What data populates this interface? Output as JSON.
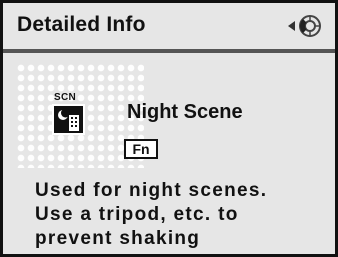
{
  "header": {
    "title": "Detailed Info",
    "nav_icon": "four-way-controller-icon"
  },
  "mode": {
    "scn_label": "SCN",
    "icon": "night-scene-icon",
    "name": "Night Scene",
    "fn_label": "Fn"
  },
  "description": {
    "lines": [
      "Used for night scenes.",
      "Use a tripod, etc. to",
      "prevent shaking"
    ]
  }
}
